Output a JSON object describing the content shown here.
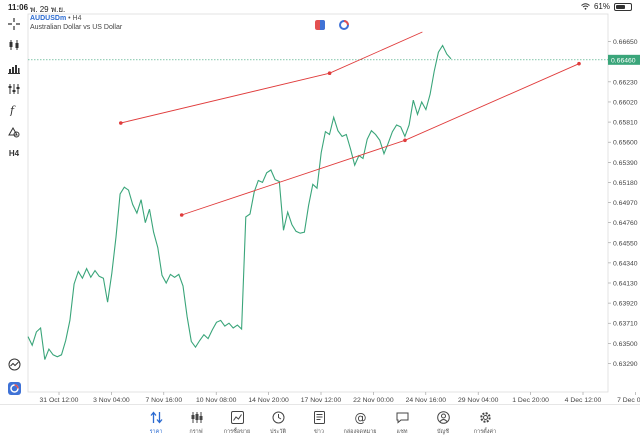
{
  "status": {
    "time": "11:06",
    "date": "พ. 29 พ.ย.",
    "battery": "61%",
    "battery_level": 0.61
  },
  "symbol": {
    "name": "AUDUSDm",
    "timeframe": "H4",
    "description": "Australian Dollar vs US Dollar"
  },
  "toolbar_icons": [
    "crosshair-icon",
    "candles-icon",
    "bars-icon",
    "indicators-icon",
    "function-icon",
    "objects-icon",
    "timeframe-icon"
  ],
  "current_price": "0.66460",
  "colors": {
    "line": "#3aa57a",
    "trendline": "#e03c3c",
    "accent": "#2a6ad1",
    "price_tag": "#3aa57a"
  },
  "chart_data": {
    "type": "line",
    "yticks": [
      "0.66650",
      "0.66440",
      "0.66230",
      "0.66020",
      "0.65810",
      "0.65600",
      "0.65390",
      "0.65180",
      "0.64970",
      "0.64760",
      "0.64550",
      "0.64340",
      "0.64130",
      "0.63920",
      "0.63710",
      "0.63500",
      "0.63290"
    ],
    "xticks": [
      "31 Oct 12:00",
      "3 Nov 04:00",
      "7 Nov 16:00",
      "10 Nov 08:00",
      "14 Nov 20:00",
      "17 Nov 12:00",
      "22 Nov 00:00",
      "24 Nov 16:00",
      "29 Nov 04:00",
      "1 Dec 20:00",
      "4 Dec 12:00",
      "7 Dec 04:00"
    ],
    "ylim": [
      0.6318,
      0.6674
    ],
    "current_price": 0.6646,
    "series": [
      {
        "values": [
          0.6357,
          0.6348,
          0.6362,
          0.6366,
          0.6333,
          0.6344,
          0.6338,
          0.6336,
          0.6338,
          0.6353,
          0.6374,
          0.6412,
          0.6425,
          0.6418,
          0.6428,
          0.6419,
          0.6426,
          0.642,
          0.6418,
          0.6393,
          0.6423,
          0.6461,
          0.6506,
          0.6513,
          0.651,
          0.6495,
          0.6486,
          0.65,
          0.6476,
          0.649,
          0.6466,
          0.645,
          0.6421,
          0.6413,
          0.6422,
          0.6419,
          0.6422,
          0.641,
          0.6378,
          0.6352,
          0.6346,
          0.6353,
          0.6359,
          0.6355,
          0.6364,
          0.6372,
          0.6374,
          0.6368,
          0.6371,
          0.6366,
          0.6369,
          0.6365,
          0.6482,
          0.6485,
          0.6508,
          0.652,
          0.6518,
          0.6528,
          0.6531,
          0.6521,
          0.6519,
          0.6468,
          0.6487,
          0.6474,
          0.6467,
          0.6465,
          0.6466,
          0.6494,
          0.6516,
          0.6512,
          0.6549,
          0.6571,
          0.6568,
          0.6586,
          0.6572,
          0.6566,
          0.6568,
          0.6553,
          0.6536,
          0.6546,
          0.6543,
          0.6563,
          0.6572,
          0.6568,
          0.6562,
          0.6548,
          0.6559,
          0.6571,
          0.6578,
          0.6576,
          0.6566,
          0.6578,
          0.6604,
          0.6589,
          0.6602,
          0.6594,
          0.661,
          0.6634,
          0.6654,
          0.6661,
          0.6652,
          0.6647
        ]
      }
    ],
    "trendlines": [
      {
        "points": [
          [
            0.16,
            0.658
          ],
          [
            0.52,
            0.6632
          ],
          [
            0.68,
            0.6675
          ]
        ]
      },
      {
        "points": [
          [
            0.265,
            0.6484
          ],
          [
            0.65,
            0.6562
          ],
          [
            0.95,
            0.6642
          ]
        ]
      }
    ]
  },
  "nav": [
    {
      "label": "ราคา",
      "icon": "quotes-icon",
      "active": true
    },
    {
      "label": "กราฟ",
      "icon": "chart-icon",
      "active": false
    },
    {
      "label": "การซื้อขาย",
      "icon": "trade-icon",
      "active": false
    },
    {
      "label": "ประวัติ",
      "icon": "history-icon",
      "active": false
    },
    {
      "label": "ข่าว",
      "icon": "news-icon",
      "active": false
    },
    {
      "label": "กล่องจดหมาย",
      "icon": "mailbox-icon",
      "active": false
    },
    {
      "label": "แชท",
      "icon": "chat-icon",
      "active": false
    },
    {
      "label": "บัญชี",
      "icon": "account-icon",
      "active": false
    },
    {
      "label": "การตั้งค่า",
      "icon": "settings-icon",
      "active": false
    }
  ]
}
